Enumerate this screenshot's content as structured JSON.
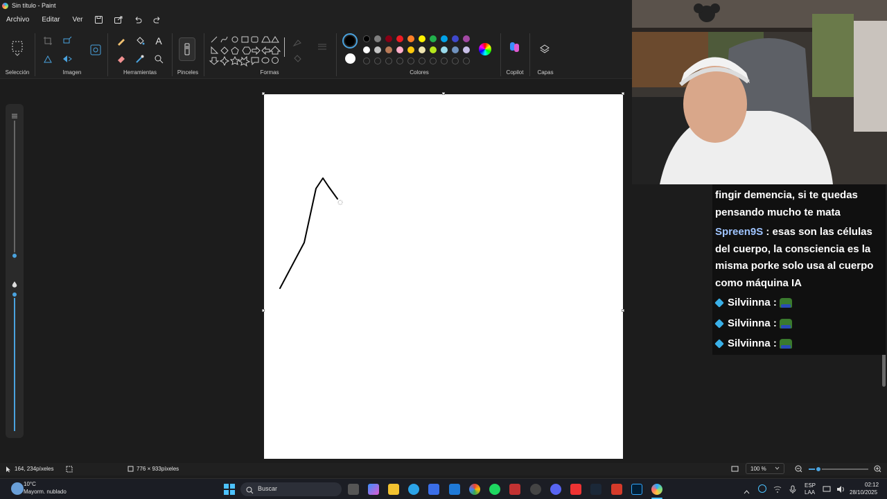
{
  "window": {
    "title": "Sin título - Paint"
  },
  "menu": {
    "file": "Archivo",
    "edit": "Editar",
    "view": "Ver"
  },
  "ribbon": {
    "selection_label": "Selección",
    "image_label": "Imagen",
    "tools_label": "Herramientas",
    "brushes_label": "Pinceles",
    "shapes_label": "Formas",
    "colors_label": "Colores",
    "copilot_label": "Copilot",
    "layers_label": "Capas",
    "text_tool_glyph": "A",
    "palette_row1": [
      "#000000",
      "#7f7f7f",
      "#880015",
      "#ed1c24",
      "#ff7f27",
      "#fff200",
      "#22b14c",
      "#00a2e8",
      "#3f48cc",
      "#a349a4"
    ],
    "palette_row2": [
      "#ffffff",
      "#c3c3c3",
      "#b97a57",
      "#ffaec9",
      "#ffc90e",
      "#efe4b0",
      "#b5e61d",
      "#99d9ea",
      "#7092be",
      "#c8bfe7"
    ],
    "primary_color": "#000000",
    "secondary_color": "#ffffff"
  },
  "status": {
    "cursor_position": "164, 234píxeles",
    "canvas_size": "776 × 933píxeles",
    "zoom": "100 %"
  },
  "taskbar": {
    "temperature": "10°C",
    "weather": "Mayorm. nublado",
    "search_placeholder": "Buscar",
    "language": "ESP",
    "keyboard": "LAA",
    "time": "02:12",
    "date": "28/10/2025"
  },
  "chat": {
    "messages": [
      {
        "user": "",
        "text": "fingir demencia, si te quedas pensando mucho te mata"
      },
      {
        "user": "Spreen9S",
        "text": ": esas son las células del cuerpo, la consciencia es la misma porke solo usa al cuerpo como máquina IA"
      },
      {
        "user": "Silviinna",
        "text": ":"
      },
      {
        "user": "Silviinna",
        "text": ":"
      },
      {
        "user": "Silviinna",
        "text": ":"
      }
    ]
  }
}
